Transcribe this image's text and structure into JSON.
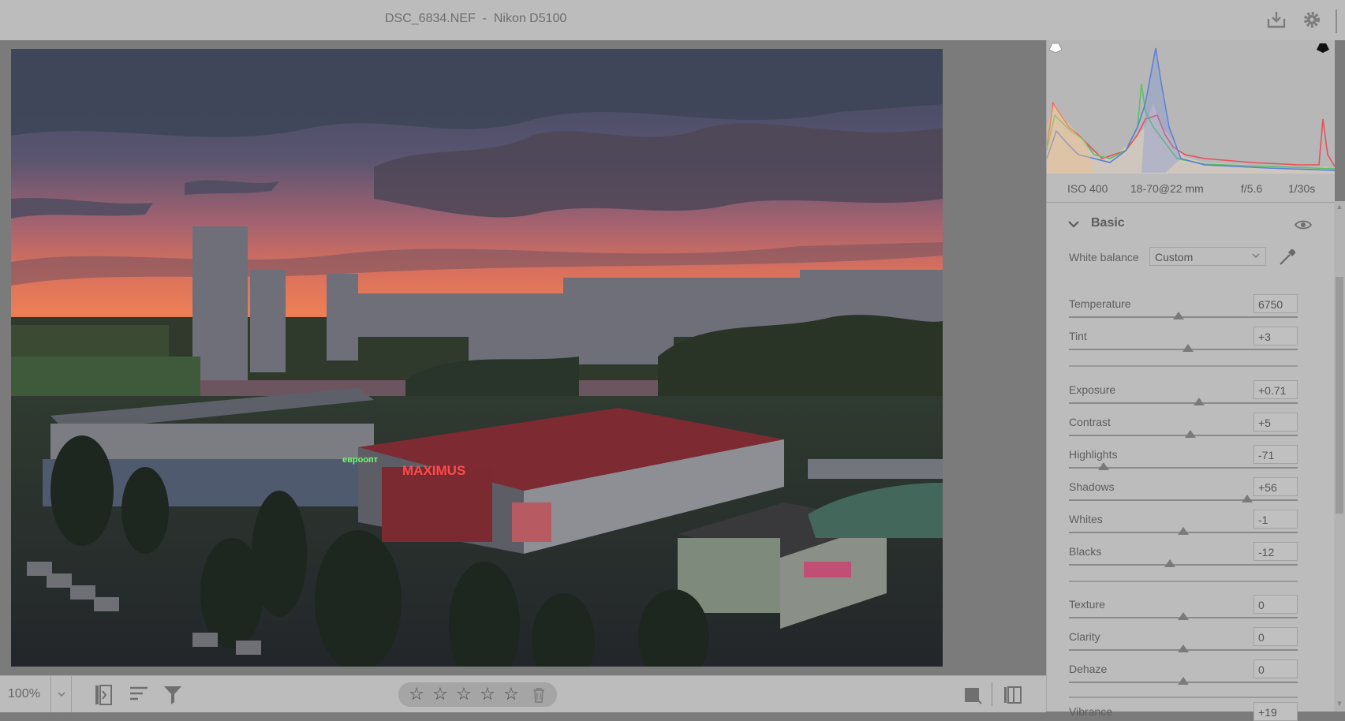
{
  "header": {
    "title": "DSC_6834.NEF  -  Nikon D5100",
    "export_icon": "download-tray-icon",
    "settings_icon": "gear-icon"
  },
  "exif": {
    "iso": "ISO 400",
    "lens": "18-70@22 mm",
    "aperture": "f/5.6",
    "shutter": "1/30s"
  },
  "basic": {
    "title": "Basic",
    "white_balance": {
      "label": "White balance",
      "value": "Custom"
    },
    "sliders": {
      "temperature": {
        "label": "Temperature",
        "value": "6750",
        "position": 0.48
      },
      "tint": {
        "label": "Tint",
        "value": "+3",
        "position": 0.52
      },
      "exposure": {
        "label": "Exposure",
        "value": "+0.71",
        "position": 0.57
      },
      "contrast": {
        "label": "Contrast",
        "value": "+5",
        "position": 0.53
      },
      "highlights": {
        "label": "Highlights",
        "value": "-71",
        "position": 0.15
      },
      "shadows": {
        "label": "Shadows",
        "value": "+56",
        "position": 0.78
      },
      "whites": {
        "label": "Whites",
        "value": "-1",
        "position": 0.5
      },
      "blacks": {
        "label": "Blacks",
        "value": "-12",
        "position": 0.44
      },
      "texture": {
        "label": "Texture",
        "value": "0",
        "position": 0.5
      },
      "clarity": {
        "label": "Clarity",
        "value": "0",
        "position": 0.5
      },
      "dehaze": {
        "label": "Dehaze",
        "value": "0",
        "position": 0.5
      },
      "vibrance": {
        "label": "Vibrance",
        "value": "+19"
      }
    }
  },
  "toolbar": {
    "zoom": "100%",
    "rating": 0,
    "stars": [
      "☆",
      "☆",
      "☆",
      "☆",
      "☆"
    ]
  },
  "colors": {
    "panel_bg": "#bcbcbc",
    "viewer_bg": "#7b7b7b",
    "histogram_red": "#e8505a",
    "histogram_green": "#5cc06a",
    "histogram_blue": "#5b7fd6"
  }
}
